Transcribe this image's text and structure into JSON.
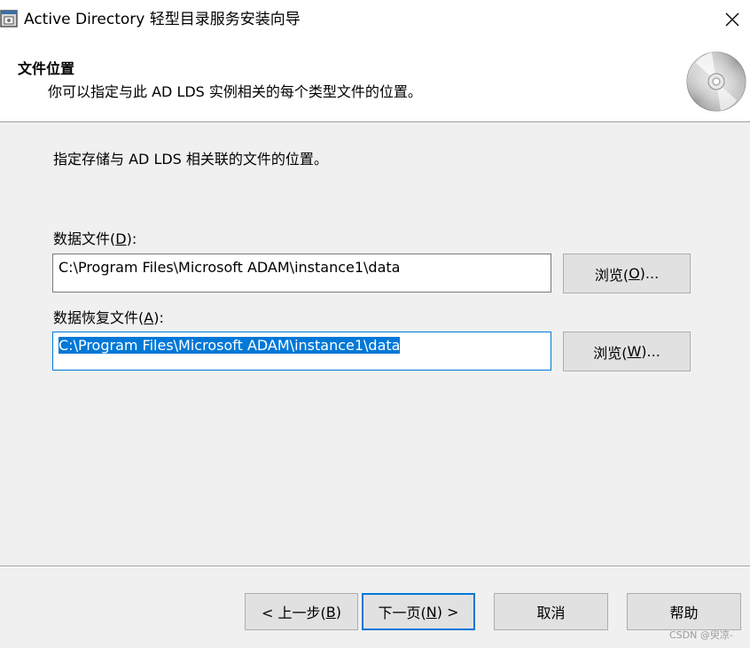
{
  "window": {
    "title": "Active Directory 轻型目录服务安装向导"
  },
  "header": {
    "title": "文件位置",
    "description": "你可以指定与此 AD LDS 实例相关的每个类型文件的位置。"
  },
  "body": {
    "instruction": "指定存储与 AD LDS 相关联的文件的位置。",
    "data_files": {
      "label_prefix": "数据文件(",
      "label_accel": "D",
      "label_suffix": "):",
      "value": "C:\\Program Files\\Microsoft ADAM\\instance1\\data",
      "browse_prefix": "浏览(",
      "browse_accel": "O",
      "browse_suffix": ")..."
    },
    "recovery_files": {
      "label_prefix": "数据恢复文件(",
      "label_accel": "A",
      "label_suffix": "):",
      "value": "C:\\Program Files\\Microsoft ADAM\\instance1\\data",
      "browse_prefix": "浏览(",
      "browse_accel": "W",
      "browse_suffix": ")..."
    }
  },
  "footer": {
    "back_prefix": "< 上一步(",
    "back_accel": "B",
    "back_suffix": ")",
    "next_prefix": "下一页(",
    "next_accel": "N",
    "next_suffix": ") >",
    "cancel": "取消",
    "help": "帮助"
  },
  "watermark": "CSDN @臾凉-",
  "colors": {
    "accent": "#0078d7",
    "button_bg": "#e1e1e1",
    "window_bg": "#f0f0f0"
  },
  "icons": {
    "app": "wizard-app-icon",
    "close": "close-icon",
    "header": "cd-disc-icon"
  }
}
